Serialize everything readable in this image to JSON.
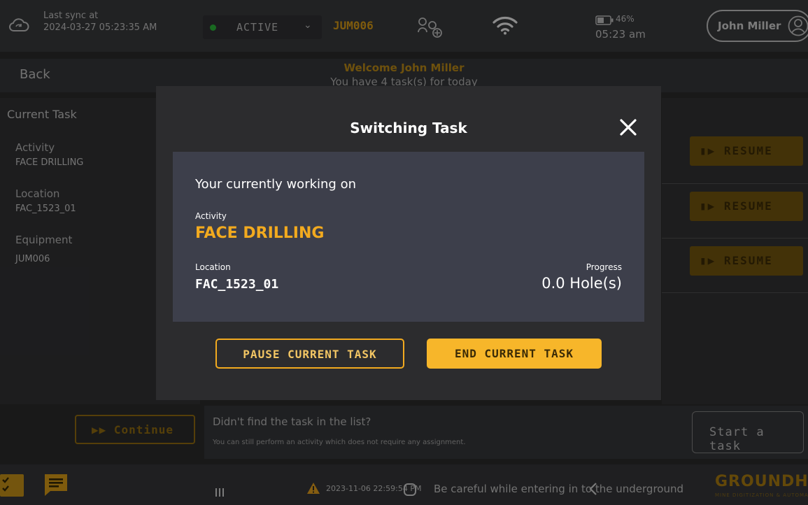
{
  "status_bar": {
    "sync_label": "Last sync at",
    "sync_time": "2024-03-27 05:23:35 AM",
    "status": "ACTIVE",
    "equipment": "JUM006",
    "battery": "46%",
    "time": "05:23 am",
    "user": "John Miller",
    "icons": [
      "cloud-sync-icon",
      "crew-icon",
      "wifi-icon",
      "battery-icon",
      "user-avatar-icon"
    ],
    "colors": {
      "active_dot": "#2ec13c",
      "accent": "#e7a718"
    }
  },
  "header": {
    "back_label": "Back",
    "welcome": "Welcome John Miller",
    "tasks_today": "You have 4 task(s) for today"
  },
  "current_task_panel": {
    "title": "Current Task",
    "activity_label": "Activity",
    "activity_value": "FACE DRILLING",
    "location_label": "Location",
    "location_value": "FAC_1523_01",
    "equipment_label": "Equipment",
    "equipment_value": "JUM006"
  },
  "task_list": {
    "resume_label": "RESUME"
  },
  "continue_label": "Continue",
  "no_task": {
    "title": "Didn't find the task in the list?",
    "subtitle": "You can still perform an activity which does not require any assignment.",
    "start_label": "Start a task"
  },
  "bottom_bar": {
    "alert_time": "2023-11-06 22:59:54 PM",
    "alert_message": "Be careful while entering in to the underground",
    "brand": "GROUNDHOG",
    "brand_sub": "MINE DIGITIZATION & AUTOMATION"
  },
  "modal": {
    "title": "Switching Task",
    "heading": "Your currently working on",
    "activity_label": "Activity",
    "activity_value": "FACE DRILLING",
    "location_label": "Location",
    "location_value": "FAC_1523_01",
    "progress_label": "Progress",
    "progress_value": "0.0 Hole(s)",
    "pause_label": "PAUSE CURRENT TASK",
    "end_label": "END CURRENT TASK",
    "colors": {
      "accent": "#f2aa1f",
      "card": "#3d3f4b"
    }
  }
}
